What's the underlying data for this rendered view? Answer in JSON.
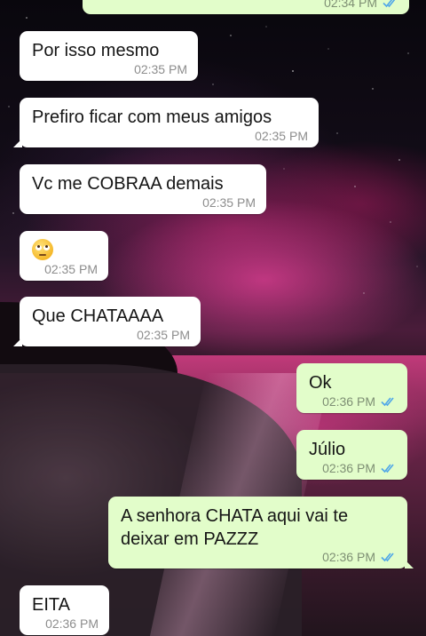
{
  "colors": {
    "incoming_bubble": "#ffffff",
    "outgoing_bubble": "#e2fdca",
    "read_ticks": "#4fa6e8",
    "timestamp": "#8d8d8d"
  },
  "messages": [
    {
      "direction": "out",
      "text": "",
      "time": "02:34 PM",
      "read": true
    },
    {
      "direction": "in",
      "text": "Por isso mesmo",
      "time": "02:35 PM"
    },
    {
      "direction": "in",
      "text": "Prefiro ficar com meus amigos",
      "time": "02:35 PM"
    },
    {
      "direction": "in",
      "text": "Vc me COBRAA demais",
      "time": "02:35 PM"
    },
    {
      "direction": "in",
      "text": "",
      "emoji": "face-with-rolling-eyes-icon",
      "time": "02:35 PM"
    },
    {
      "direction": "in",
      "text": "Que CHATAAAA",
      "time": "02:35 PM"
    },
    {
      "direction": "out",
      "text": "Ok",
      "time": "02:36 PM",
      "read": true
    },
    {
      "direction": "out",
      "text": "Júlio",
      "time": "02:36 PM",
      "read": true
    },
    {
      "direction": "out",
      "text": "A senhora CHATA aqui vai te\ndeixar em PAZZZ",
      "time": "02:36 PM",
      "read": true
    },
    {
      "direction": "in",
      "text": "EITA",
      "time": "02:36 PM"
    }
  ]
}
